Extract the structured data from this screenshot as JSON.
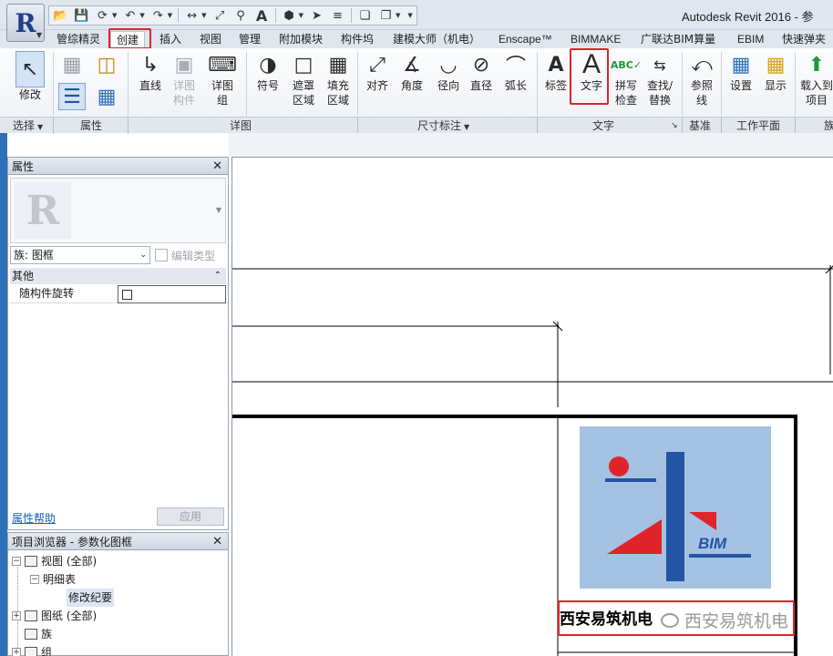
{
  "window": {
    "title": "Autodesk Revit 2016 -   参"
  },
  "quick_access": {
    "items": [
      "open-icon",
      "save-icon",
      "sync-icon",
      "undo-icon",
      "redo-icon",
      "measure-icon",
      "dimension-icon",
      "tag-icon",
      "text-icon",
      "3d-view-icon",
      "section-icon",
      "thin-lines-icon",
      "close-windows-icon",
      "switch-windows-icon"
    ]
  },
  "ribbon": {
    "tabs": [
      "管综精灵",
      "创建",
      "插入",
      "视图",
      "管理",
      "附加模块",
      "构件坞",
      "建模大师（机电）",
      "Enscape™",
      "BIMMAKE",
      "广联达BIM算量",
      "EBIM",
      "快速弹夹"
    ],
    "active_tab": "创建",
    "buttons": {
      "modify": "修改",
      "line": "直线",
      "detail_component_1": "详图",
      "detail_component_2": "构件",
      "detail_group_1": "详图",
      "detail_group_2": "组",
      "symbol": "符号",
      "masking_1": "遮罩",
      "masking_2": "区域",
      "filled_1": "填充",
      "filled_2": "区域",
      "aligned": "对齐",
      "angular": "角度",
      "radial": "径向",
      "diameter": "直径",
      "arc_length": "弧长",
      "label": "标签",
      "text": "文字",
      "spelling_1": "拼写",
      "spelling_2": "检查",
      "find_1": "查找/",
      "find_2": "替换",
      "ref_line_1": "参照",
      "ref_line_2": "线",
      "set": "设置",
      "show": "显示",
      "load_1": "载入到",
      "load_2": "项目"
    },
    "panels": {
      "select": "选择",
      "properties": "属性",
      "detail": "详图",
      "dimension": "尺寸标注",
      "text": "文字",
      "datum": "基准",
      "work_plane": "工作平面",
      "family_editor": "族"
    }
  },
  "properties_panel": {
    "title": "属性",
    "family_selector": "族: 图框",
    "edit_type": "编辑类型",
    "group": "其他",
    "params": [
      {
        "name": "随构件旋转",
        "checked": false
      }
    ],
    "help_link": "属性帮助",
    "apply_button": "应用"
  },
  "project_browser": {
    "title": "项目浏览器 - 参数化图框",
    "tree": [
      {
        "label": "视图 (全部)",
        "level": 0,
        "expanded": true
      },
      {
        "label": "明细表",
        "level": 1,
        "expanded": true
      },
      {
        "label": "修改纪要",
        "level": 2,
        "selected": true
      },
      {
        "label": "图纸 (全部)",
        "level": 0,
        "expanded": false
      },
      {
        "label": "族",
        "level": 0,
        "expanded": false
      },
      {
        "label": "组",
        "level": 0,
        "expanded": false
      }
    ]
  },
  "canvas": {
    "logo_text": "BIM",
    "title_cell_text": "西安易筑机电",
    "watermark_text": "西安易筑机电"
  },
  "colors": {
    "highlight_red": "#d9262c",
    "logo_background": "#a6c2e3",
    "logo_blue": "#2255a4",
    "logo_red": "#e0242b",
    "accent_blue": "#2f71b8"
  }
}
